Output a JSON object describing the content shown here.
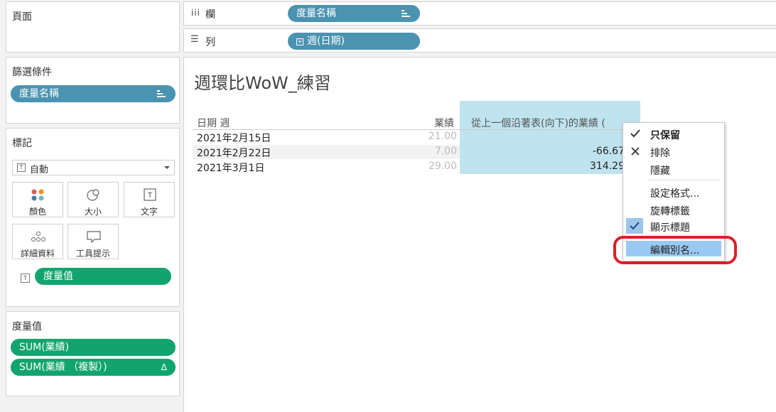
{
  "pages_card": {
    "title": "頁面"
  },
  "filters_card": {
    "title": "篩選條件",
    "pill": "度量名稱"
  },
  "marks_card": {
    "title": "標記",
    "mark_type": "自動",
    "buttons": [
      {
        "label": "顏色",
        "icon": "color-dots-icon"
      },
      {
        "label": "大小",
        "icon": "size-icon"
      },
      {
        "label": "文字",
        "icon": "text-icon"
      },
      {
        "label": "詳細資料",
        "icon": "detail-icon"
      },
      {
        "label": "工具提示",
        "icon": "tooltip-icon"
      }
    ],
    "text_pill": "度量值"
  },
  "measure_values_card": {
    "title": "度量值",
    "pills": [
      {
        "label": "SUM(業績)",
        "tail": ""
      },
      {
        "label": "SUM(業績 （複製）)",
        "tail": "Δ"
      }
    ]
  },
  "shelves": {
    "columns": {
      "label": "欄",
      "pill": "度量名稱"
    },
    "rows": {
      "label": "列",
      "pill": "週(日期)"
    }
  },
  "view": {
    "title": "週環比WoW_練習",
    "headers": [
      "日期 週",
      "業績",
      "從上一個沿著表(向下)的業績 ("
    ],
    "rows": [
      {
        "date": "2021年2月15日",
        "sales": "21.00",
        "diff": ""
      },
      {
        "date": "2021年2月22日",
        "sales": "7.00",
        "diff": "-66.67"
      },
      {
        "date": "2021年3月1日",
        "sales": "29.00",
        "diff": "314.29"
      }
    ]
  },
  "context_menu": {
    "items": [
      {
        "label": "只保留",
        "icon": "check-icon"
      },
      {
        "label": "排除",
        "icon": "x-icon"
      },
      {
        "label": "隱藏",
        "icon": ""
      },
      {
        "label": "設定格式...",
        "icon": ""
      },
      {
        "label": "旋轉標籤",
        "icon": ""
      },
      {
        "label": "顯示標題",
        "icon": "checked-icon"
      },
      {
        "label": "編輯別名...",
        "icon": ""
      }
    ]
  },
  "colors": {
    "shelf_pill": "#4a93b1",
    "measure_pill": "#12a46f",
    "highlight_column": "#bfe3ef",
    "menu_highlight": "#99c9f2",
    "annotation_red": "#d9202a"
  }
}
